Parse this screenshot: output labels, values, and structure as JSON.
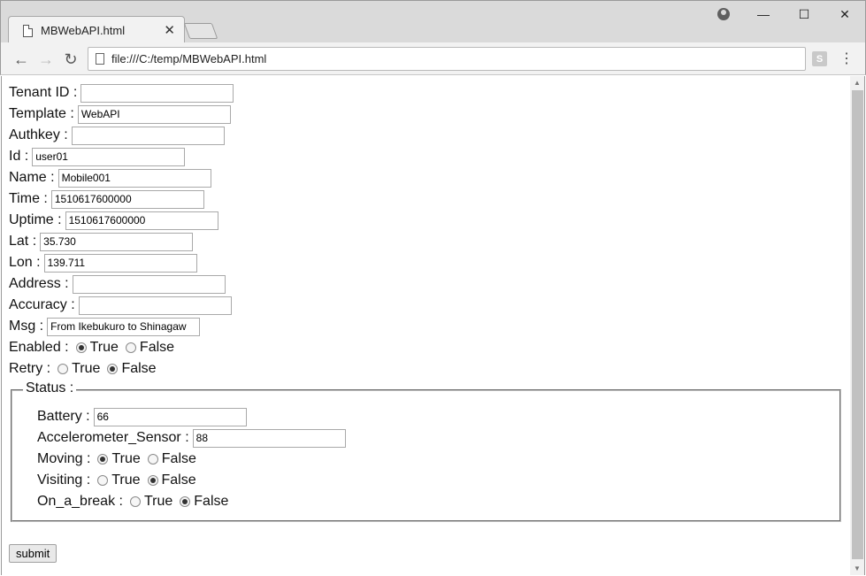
{
  "browser": {
    "tab_title": "MBWebAPI.html",
    "tab_close": "✕",
    "url": "file:///C:/temp/MBWebAPI.html",
    "ext_label": "S",
    "window_controls": {
      "minimize": "—",
      "maximize": "☐",
      "close": "✕"
    },
    "nav": {
      "back": "←",
      "forward": "→",
      "reload": "↻",
      "menu": "⋮"
    }
  },
  "form": {
    "tenant_id": {
      "label": "Tenant ID :",
      "value": ""
    },
    "template": {
      "label": "Template :",
      "value": "WebAPI"
    },
    "authkey": {
      "label": "Authkey :",
      "value": ""
    },
    "id": {
      "label": "Id :",
      "value": "user01"
    },
    "name": {
      "label": "Name :",
      "value": "Mobile001"
    },
    "time": {
      "label": "Time :",
      "value": "1510617600000"
    },
    "uptime": {
      "label": "Uptime :",
      "value": "1510617600000"
    },
    "lat": {
      "label": "Lat :",
      "value": "35.730"
    },
    "lon": {
      "label": "Lon :",
      "value": "139.711"
    },
    "address": {
      "label": "Address :",
      "value": ""
    },
    "accuracy": {
      "label": "Accuracy :",
      "value": ""
    },
    "msg": {
      "label": "Msg :",
      "value": "From Ikebukuro to Shinagaw"
    },
    "enabled": {
      "label": "Enabled :",
      "true_label": "True",
      "false_label": "False",
      "selected": "True"
    },
    "retry": {
      "label": "Retry :",
      "true_label": "True",
      "false_label": "False",
      "selected": "False"
    },
    "status": {
      "legend": "Status :",
      "battery": {
        "label": "Battery :",
        "value": "66"
      },
      "accelerometer": {
        "label": "Accelerometer_Sensor :",
        "value": "88"
      },
      "moving": {
        "label": "Moving :",
        "true_label": "True",
        "false_label": "False",
        "selected": "True"
      },
      "visiting": {
        "label": "Visiting :",
        "true_label": "True",
        "false_label": "False",
        "selected": "False"
      },
      "on_a_break": {
        "label": "On_a_break :",
        "true_label": "True",
        "false_label": "False",
        "selected": "False"
      }
    },
    "submit_label": "submit"
  }
}
